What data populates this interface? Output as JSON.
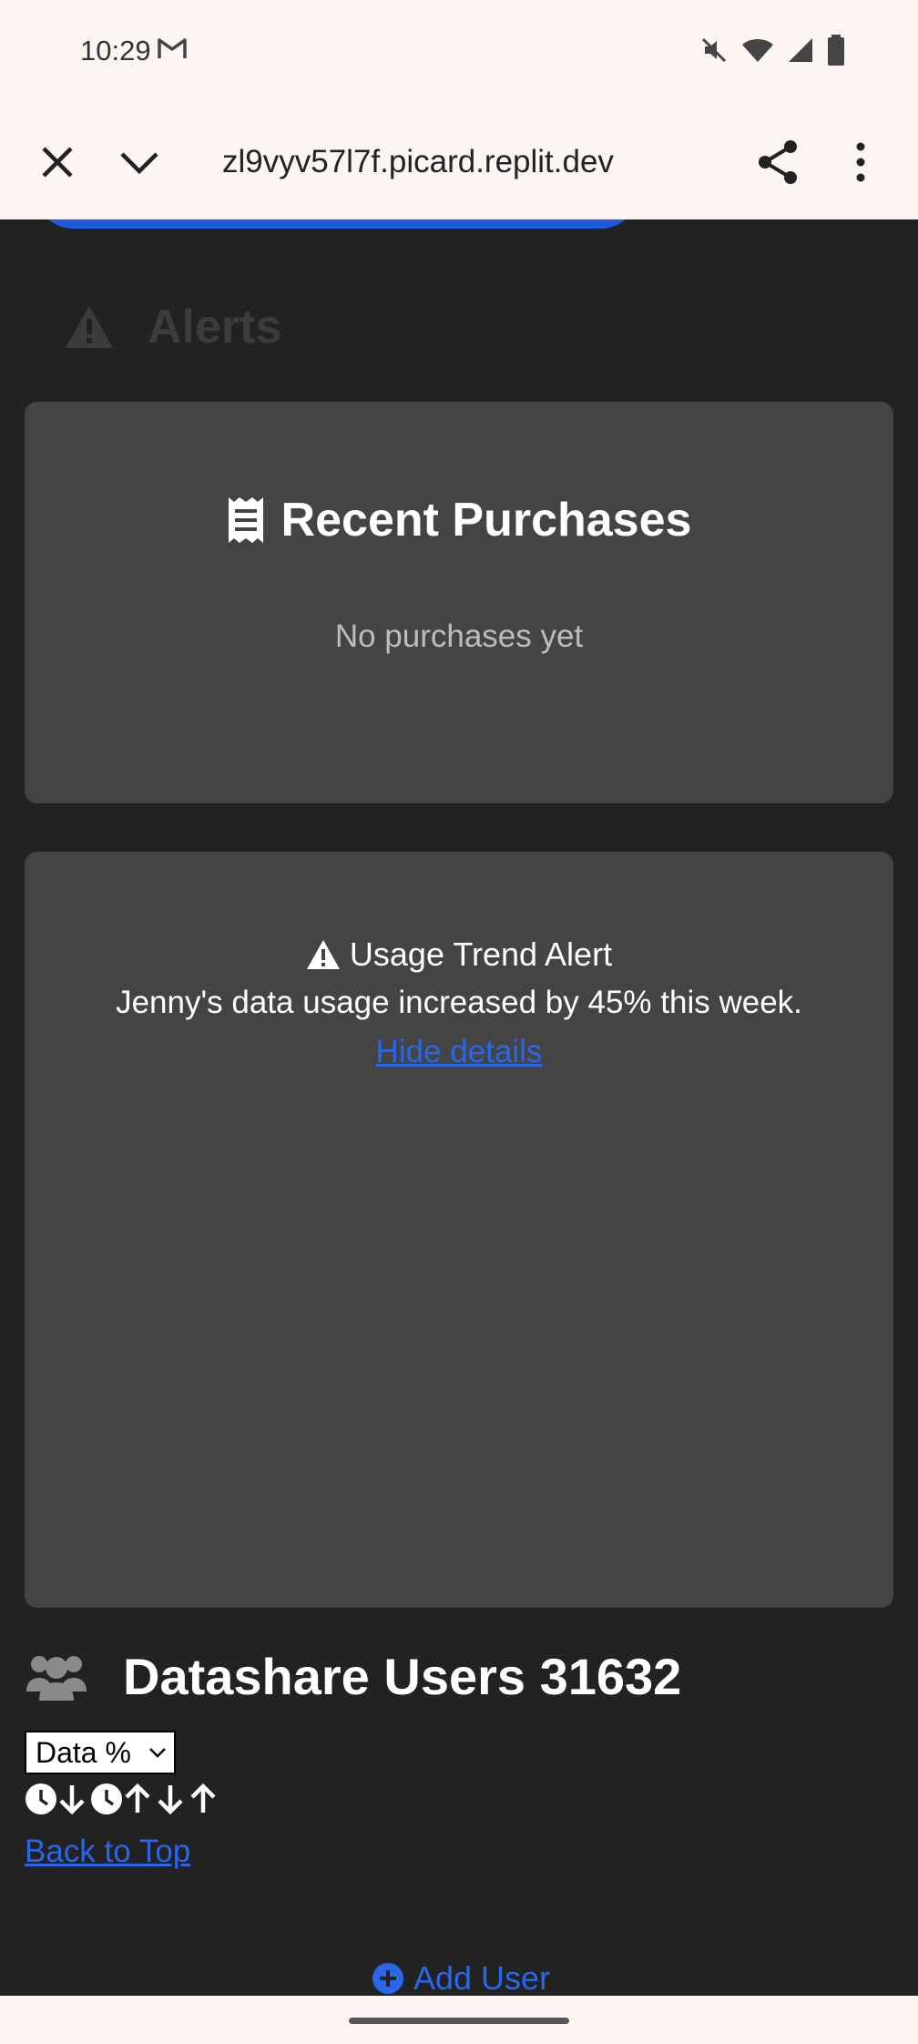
{
  "status_bar": {
    "time": "10:29"
  },
  "browser": {
    "url": "zl9vyv57l7f.picard.replit.dev"
  },
  "alerts_section": {
    "title": "Alerts"
  },
  "purchases_card": {
    "title": "Recent Purchases",
    "empty_text": "No purchases yet"
  },
  "usage_alert": {
    "title": "Usage Trend Alert",
    "message": "Jenny's data usage increased by 45% this week.",
    "toggle_link": "Hide details"
  },
  "users_section": {
    "title": "Datashare Users 31632",
    "sort_select_value": "Data %",
    "back_to_top": "Back to Top",
    "add_user": "Add User"
  },
  "colors": {
    "background": "#222222",
    "card": "#444444",
    "link": "#2a66e8",
    "accent_blue": "#1f5be0"
  }
}
